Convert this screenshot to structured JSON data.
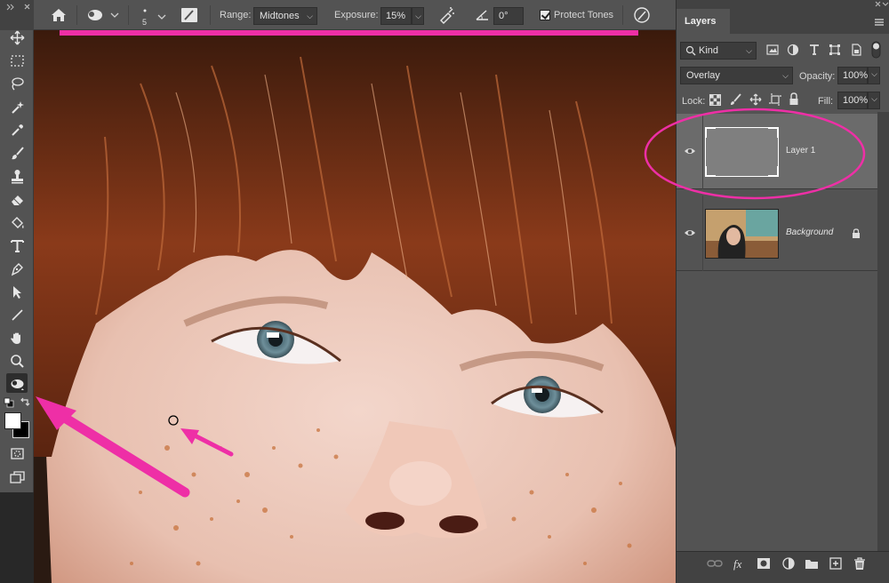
{
  "options_bar": {
    "brush_size": "5",
    "range_label": "Range:",
    "range_value": "Midtones",
    "exposure_label": "Exposure:",
    "exposure_value": "15%",
    "angle_value": "0°",
    "protect_tones_label": "Protect Tones",
    "protect_tones_checked": true
  },
  "toolbar": {
    "tools": [
      "move-tool",
      "rectangular-marquee-tool",
      "lasso-tool",
      "quick-selection-tool",
      "eyedropper-tool",
      "spot-healing-brush-tool",
      "brush-tool",
      "clone-stamp-tool",
      "eraser-tool",
      "paint-bucket-tool",
      "type-tool",
      "pen-tool",
      "path-selection-tool",
      "line-tool",
      "hand-tool",
      "zoom-tool",
      "burn-tool"
    ],
    "active_tool": "burn-tool"
  },
  "layers_panel": {
    "tab_label": "Layers",
    "filter_kind": "Kind",
    "blend_mode": "Overlay",
    "opacity_label": "Opacity:",
    "opacity_value": "100%",
    "lock_label": "Lock:",
    "fill_label": "Fill:",
    "fill_value": "100%",
    "layers": [
      {
        "name": "Layer 1",
        "selected": true,
        "visible": true,
        "locked": false
      },
      {
        "name": "Background",
        "selected": false,
        "visible": true,
        "locked": true
      }
    ]
  },
  "colors": {
    "annotation_pink": "#ee2fa6",
    "panel_bg": "#535353",
    "dark_bg": "#424242",
    "selected_layer_bg": "#6b6b6b"
  }
}
